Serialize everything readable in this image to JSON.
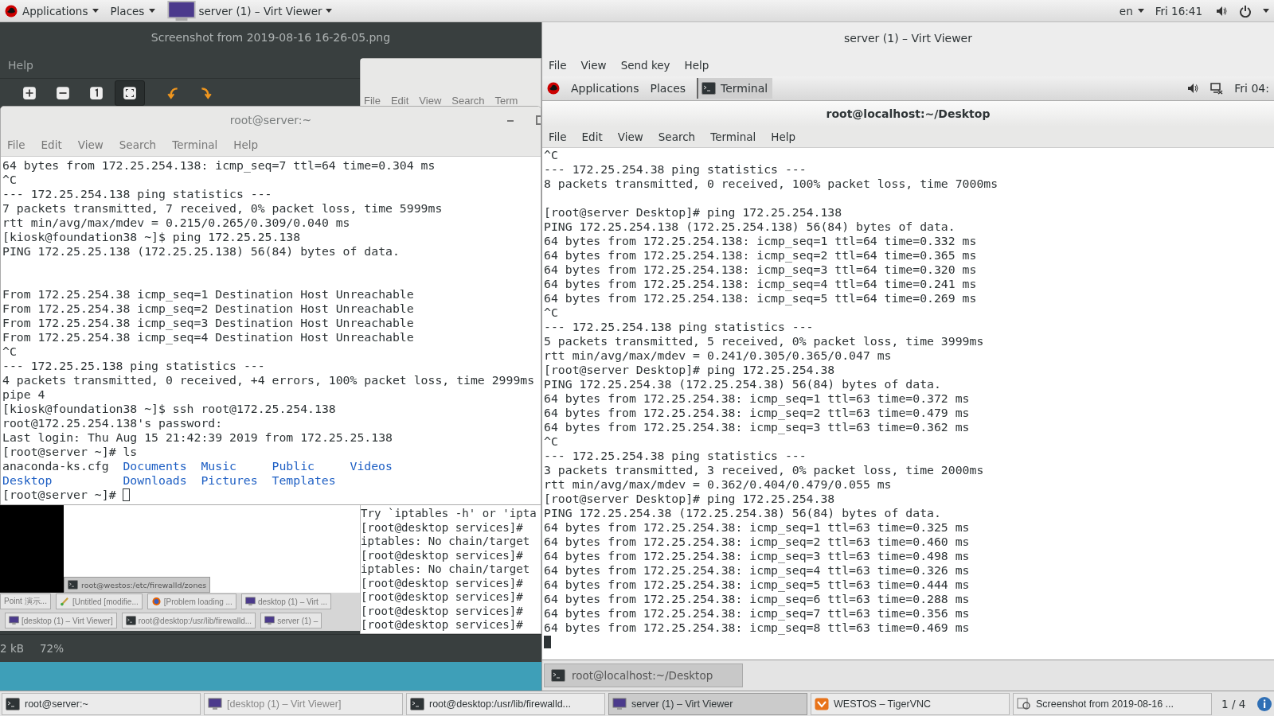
{
  "top_bar": {
    "menus": [
      {
        "label": "Applications"
      },
      {
        "label": "Places"
      }
    ],
    "window_menu": "server (1) – Virt Viewer",
    "language": "en",
    "clock": "Fri 16:41"
  },
  "image_viewer": {
    "title": "Screenshot from 2019-08-16 16-26-05.png",
    "menu": [
      "Help"
    ],
    "tools": [
      {
        "kind": "zoom-in",
        "selected": false
      },
      {
        "kind": "zoom-out",
        "selected": false
      },
      {
        "kind": "normal-size",
        "selected": false
      },
      {
        "kind": "best-fit",
        "selected": true
      },
      {
        "kind": "rotate-left",
        "selected": false
      },
      {
        "kind": "rotate-right",
        "selected": false
      }
    ],
    "screenshot": {
      "back_terminal": {
        "menu": [
          "File",
          "Edit",
          "View",
          "Search",
          "Term"
        ],
        "lines": [
          "Try `iptables -h' or 'ipta",
          "[root@desktop services]# ",
          "iptables: No chain/target",
          "[root@desktop services]# ",
          "iptables: No chain/target",
          "[root@desktop services]# ",
          "[root@desktop services]# ",
          "[root@desktop services]# ",
          "[root@desktop services]# "
        ]
      },
      "panel_button": "root@westos:/etc/firewalld/zones",
      "taskbar_rows": [
        [
          {
            "label": "Point 演示...",
            "kind": "text-only"
          },
          {
            "label": "[Untitled [modifie...",
            "kind": "paint"
          },
          {
            "label": "[Problem loading ...",
            "kind": "browser"
          },
          {
            "label": "desktop (1) – Virt ...",
            "kind": "monitor"
          }
        ],
        [
          {
            "label": "[desktop (1) – Virt Viewer]",
            "kind": "monitor"
          },
          {
            "label": "root@desktop:/usr/lib/firewalld...",
            "kind": "terminal"
          },
          {
            "label": "server (1) –",
            "kind": "monitor"
          }
        ]
      ]
    },
    "status": [
      "2 kB",
      "72%"
    ]
  },
  "terminal": {
    "title": "root@server:~",
    "menu": [
      "File",
      "Edit",
      "View",
      "Search",
      "Terminal",
      "Help"
    ],
    "cursor_focused": false,
    "lines": [
      {
        "kind": "text",
        "text": "64 bytes from 172.25.254.138: icmp_seq=7 ttl=64 time=0.304 ms"
      },
      {
        "kind": "text",
        "text": "^C"
      },
      {
        "kind": "text",
        "text": "--- 172.25.254.138 ping statistics ---"
      },
      {
        "kind": "text",
        "text": "7 packets transmitted, 7 received, 0% packet loss, time 5999ms"
      },
      {
        "kind": "text",
        "text": "rtt min/avg/max/mdev = 0.215/0.265/0.309/0.040 ms"
      },
      {
        "kind": "text",
        "text": "[kiosk@foundation38 ~]$ ping 172.25.25.138"
      },
      {
        "kind": "text",
        "text": "PING 172.25.25.138 (172.25.25.138) 56(84) bytes of data."
      },
      {
        "kind": "blank"
      },
      {
        "kind": "blank"
      },
      {
        "kind": "text",
        "text": "From 172.25.254.38 icmp_seq=1 Destination Host Unreachable"
      },
      {
        "kind": "text",
        "text": "From 172.25.254.38 icmp_seq=2 Destination Host Unreachable"
      },
      {
        "kind": "text",
        "text": "From 172.25.254.38 icmp_seq=3 Destination Host Unreachable"
      },
      {
        "kind": "text",
        "text": "From 172.25.254.38 icmp_seq=4 Destination Host Unreachable"
      },
      {
        "kind": "text",
        "text": "^C"
      },
      {
        "kind": "text",
        "text": "--- 172.25.25.138 ping statistics ---"
      },
      {
        "kind": "text",
        "text": "4 packets transmitted, 0 received, +4 errors, 100% packet loss, time 2999ms"
      },
      {
        "kind": "text",
        "text": "pipe 4"
      },
      {
        "kind": "text",
        "text": "[kiosk@foundation38 ~]$ ssh root@172.25.254.138"
      },
      {
        "kind": "text",
        "text": "root@172.25.254.138's password:"
      },
      {
        "kind": "text",
        "text": "Last login: Thu Aug 15 21:42:39 2019 from 172.25.25.138"
      },
      {
        "kind": "text",
        "text": "[root@server ~]# ls"
      },
      {
        "kind": "ls",
        "entries": [
          {
            "name": "anaconda-ks.cfg",
            "kind": "file"
          },
          {
            "name": "Documents",
            "kind": "dir"
          },
          {
            "name": "Music",
            "kind": "dir"
          },
          {
            "name": "Public",
            "kind": "dir"
          },
          {
            "name": "Videos",
            "kind": "dir"
          }
        ]
      },
      {
        "kind": "ls",
        "entries": [
          {
            "name": "Desktop",
            "kind": "dir"
          },
          {
            "name": "Downloads",
            "kind": "dir"
          },
          {
            "name": "Pictures",
            "kind": "dir"
          },
          {
            "name": "Templates",
            "kind": "dir"
          }
        ]
      },
      {
        "kind": "prompt",
        "text": "[root@server ~]# "
      }
    ]
  },
  "virt_viewer": {
    "title": "server (1) – Virt Viewer",
    "menu": [
      "File",
      "View",
      "Send key",
      "Help"
    ],
    "guest_bar": {
      "menus": [
        "Applications",
        "Places"
      ],
      "window": "Terminal",
      "clock": "Fri 04:"
    },
    "terminal": {
      "title": "root@localhost:~/Desktop",
      "menu": [
        "File",
        "Edit",
        "View",
        "Search",
        "Terminal",
        "Help"
      ],
      "cursor_focused": true,
      "lines": [
        {
          "kind": "text",
          "text": "^C"
        },
        {
          "kind": "text",
          "text": "--- 172.25.254.38 ping statistics ---"
        },
        {
          "kind": "text",
          "text": "8 packets transmitted, 0 received, 100% packet loss, time 7000ms"
        },
        {
          "kind": "blank"
        },
        {
          "kind": "text",
          "text": "[root@server Desktop]# ping 172.25.254.138"
        },
        {
          "kind": "text",
          "text": "PING 172.25.254.138 (172.25.254.138) 56(84) bytes of data."
        },
        {
          "kind": "text",
          "text": "64 bytes from 172.25.254.138: icmp_seq=1 ttl=64 time=0.332 ms"
        },
        {
          "kind": "text",
          "text": "64 bytes from 172.25.254.138: icmp_seq=2 ttl=64 time=0.365 ms"
        },
        {
          "kind": "text",
          "text": "64 bytes from 172.25.254.138: icmp_seq=3 ttl=64 time=0.320 ms"
        },
        {
          "kind": "text",
          "text": "64 bytes from 172.25.254.138: icmp_seq=4 ttl=64 time=0.241 ms"
        },
        {
          "kind": "text",
          "text": "64 bytes from 172.25.254.138: icmp_seq=5 ttl=64 time=0.269 ms"
        },
        {
          "kind": "text",
          "text": "^C"
        },
        {
          "kind": "text",
          "text": "--- 172.25.254.138 ping statistics ---"
        },
        {
          "kind": "text",
          "text": "5 packets transmitted, 5 received, 0% packet loss, time 3999ms"
        },
        {
          "kind": "text",
          "text": "rtt min/avg/max/mdev = 0.241/0.305/0.365/0.047 ms"
        },
        {
          "kind": "text",
          "text": "[root@server Desktop]# ping 172.25.254.38"
        },
        {
          "kind": "text",
          "text": "PING 172.25.254.38 (172.25.254.38) 56(84) bytes of data."
        },
        {
          "kind": "text",
          "text": "64 bytes from 172.25.254.38: icmp_seq=1 ttl=63 time=0.372 ms"
        },
        {
          "kind": "text",
          "text": "64 bytes from 172.25.254.38: icmp_seq=2 ttl=63 time=0.479 ms"
        },
        {
          "kind": "text",
          "text": "64 bytes from 172.25.254.38: icmp_seq=3 ttl=63 time=0.362 ms"
        },
        {
          "kind": "text",
          "text": "^C"
        },
        {
          "kind": "text",
          "text": "--- 172.25.254.38 ping statistics ---"
        },
        {
          "kind": "text",
          "text": "3 packets transmitted, 3 received, 0% packet loss, time 2000ms"
        },
        {
          "kind": "text",
          "text": "rtt min/avg/max/mdev = 0.362/0.404/0.479/0.055 ms"
        },
        {
          "kind": "text",
          "text": "[root@server Desktop]# ping 172.25.254.38"
        },
        {
          "kind": "text",
          "text": "PING 172.25.254.38 (172.25.254.38) 56(84) bytes of data."
        },
        {
          "kind": "text",
          "text": "64 bytes from 172.25.254.38: icmp_seq=1 ttl=63 time=0.325 ms"
        },
        {
          "kind": "text",
          "text": "64 bytes from 172.25.254.38: icmp_seq=2 ttl=63 time=0.460 ms"
        },
        {
          "kind": "text",
          "text": "64 bytes from 172.25.254.38: icmp_seq=3 ttl=63 time=0.498 ms"
        },
        {
          "kind": "text",
          "text": "64 bytes from 172.25.254.38: icmp_seq=4 ttl=63 time=0.326 ms"
        },
        {
          "kind": "text",
          "text": "64 bytes from 172.25.254.38: icmp_seq=5 ttl=63 time=0.444 ms"
        },
        {
          "kind": "text",
          "text": "64 bytes from 172.25.254.38: icmp_seq=6 ttl=63 time=0.288 ms"
        },
        {
          "kind": "text",
          "text": "64 bytes from 172.25.254.38: icmp_seq=7 ttl=63 time=0.356 ms"
        },
        {
          "kind": "text",
          "text": "64 bytes from 172.25.254.38: icmp_seq=8 ttl=63 time=0.469 ms"
        },
        {
          "kind": "prompt"
        }
      ]
    },
    "guest_taskbar": [
      "root@localhost:~/Desktop"
    ]
  },
  "taskbar": {
    "items": [
      {
        "label": "root@server:~",
        "kind": "terminal",
        "selected": false,
        "minimized": false
      },
      {
        "label": "[desktop (1) – Virt Viewer]",
        "kind": "monitor",
        "selected": false,
        "minimized": true
      },
      {
        "label": "root@desktop:/usr/lib/firewalld...",
        "kind": "terminal",
        "selected": false,
        "minimized": false
      },
      {
        "label": "server (1) – Virt Viewer",
        "kind": "monitor",
        "selected": true,
        "minimized": false
      },
      {
        "label": "WESTOS – TigerVNC",
        "kind": "vnc",
        "selected": false,
        "minimized": false
      },
      {
        "label": "Screenshot from 2019-08-16 ...",
        "kind": "image",
        "selected": false,
        "minimized": false
      }
    ],
    "pager": "1 / 4"
  }
}
